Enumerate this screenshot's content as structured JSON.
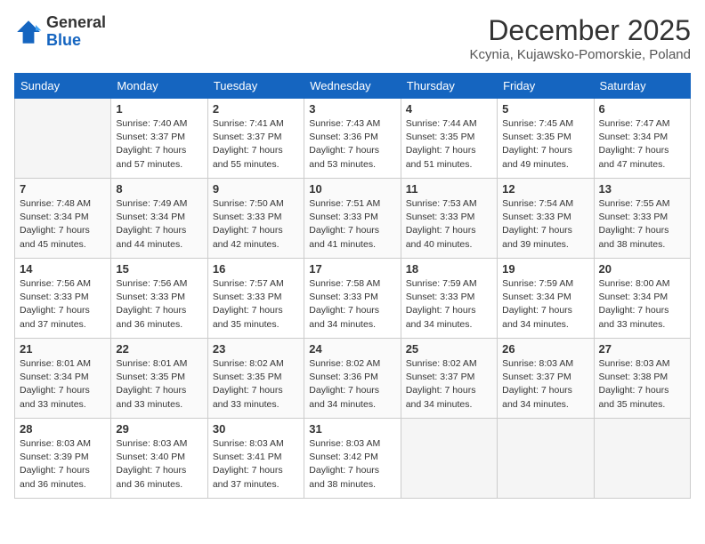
{
  "logo": {
    "general": "General",
    "blue": "Blue"
  },
  "title": "December 2025",
  "location": "Kcynia, Kujawsko-Pomorskie, Poland",
  "weekdays": [
    "Sunday",
    "Monday",
    "Tuesday",
    "Wednesday",
    "Thursday",
    "Friday",
    "Saturday"
  ],
  "weeks": [
    [
      {
        "day": "",
        "info": ""
      },
      {
        "day": "1",
        "info": "Sunrise: 7:40 AM\nSunset: 3:37 PM\nDaylight: 7 hours\nand 57 minutes."
      },
      {
        "day": "2",
        "info": "Sunrise: 7:41 AM\nSunset: 3:37 PM\nDaylight: 7 hours\nand 55 minutes."
      },
      {
        "day": "3",
        "info": "Sunrise: 7:43 AM\nSunset: 3:36 PM\nDaylight: 7 hours\nand 53 minutes."
      },
      {
        "day": "4",
        "info": "Sunrise: 7:44 AM\nSunset: 3:35 PM\nDaylight: 7 hours\nand 51 minutes."
      },
      {
        "day": "5",
        "info": "Sunrise: 7:45 AM\nSunset: 3:35 PM\nDaylight: 7 hours\nand 49 minutes."
      },
      {
        "day": "6",
        "info": "Sunrise: 7:47 AM\nSunset: 3:34 PM\nDaylight: 7 hours\nand 47 minutes."
      }
    ],
    [
      {
        "day": "7",
        "info": "Sunrise: 7:48 AM\nSunset: 3:34 PM\nDaylight: 7 hours\nand 45 minutes."
      },
      {
        "day": "8",
        "info": "Sunrise: 7:49 AM\nSunset: 3:34 PM\nDaylight: 7 hours\nand 44 minutes."
      },
      {
        "day": "9",
        "info": "Sunrise: 7:50 AM\nSunset: 3:33 PM\nDaylight: 7 hours\nand 42 minutes."
      },
      {
        "day": "10",
        "info": "Sunrise: 7:51 AM\nSunset: 3:33 PM\nDaylight: 7 hours\nand 41 minutes."
      },
      {
        "day": "11",
        "info": "Sunrise: 7:53 AM\nSunset: 3:33 PM\nDaylight: 7 hours\nand 40 minutes."
      },
      {
        "day": "12",
        "info": "Sunrise: 7:54 AM\nSunset: 3:33 PM\nDaylight: 7 hours\nand 39 minutes."
      },
      {
        "day": "13",
        "info": "Sunrise: 7:55 AM\nSunset: 3:33 PM\nDaylight: 7 hours\nand 38 minutes."
      }
    ],
    [
      {
        "day": "14",
        "info": "Sunrise: 7:56 AM\nSunset: 3:33 PM\nDaylight: 7 hours\nand 37 minutes."
      },
      {
        "day": "15",
        "info": "Sunrise: 7:56 AM\nSunset: 3:33 PM\nDaylight: 7 hours\nand 36 minutes."
      },
      {
        "day": "16",
        "info": "Sunrise: 7:57 AM\nSunset: 3:33 PM\nDaylight: 7 hours\nand 35 minutes."
      },
      {
        "day": "17",
        "info": "Sunrise: 7:58 AM\nSunset: 3:33 PM\nDaylight: 7 hours\nand 34 minutes."
      },
      {
        "day": "18",
        "info": "Sunrise: 7:59 AM\nSunset: 3:33 PM\nDaylight: 7 hours\nand 34 minutes."
      },
      {
        "day": "19",
        "info": "Sunrise: 7:59 AM\nSunset: 3:34 PM\nDaylight: 7 hours\nand 34 minutes."
      },
      {
        "day": "20",
        "info": "Sunrise: 8:00 AM\nSunset: 3:34 PM\nDaylight: 7 hours\nand 33 minutes."
      }
    ],
    [
      {
        "day": "21",
        "info": "Sunrise: 8:01 AM\nSunset: 3:34 PM\nDaylight: 7 hours\nand 33 minutes."
      },
      {
        "day": "22",
        "info": "Sunrise: 8:01 AM\nSunset: 3:35 PM\nDaylight: 7 hours\nand 33 minutes."
      },
      {
        "day": "23",
        "info": "Sunrise: 8:02 AM\nSunset: 3:35 PM\nDaylight: 7 hours\nand 33 minutes."
      },
      {
        "day": "24",
        "info": "Sunrise: 8:02 AM\nSunset: 3:36 PM\nDaylight: 7 hours\nand 34 minutes."
      },
      {
        "day": "25",
        "info": "Sunrise: 8:02 AM\nSunset: 3:37 PM\nDaylight: 7 hours\nand 34 minutes."
      },
      {
        "day": "26",
        "info": "Sunrise: 8:03 AM\nSunset: 3:37 PM\nDaylight: 7 hours\nand 34 minutes."
      },
      {
        "day": "27",
        "info": "Sunrise: 8:03 AM\nSunset: 3:38 PM\nDaylight: 7 hours\nand 35 minutes."
      }
    ],
    [
      {
        "day": "28",
        "info": "Sunrise: 8:03 AM\nSunset: 3:39 PM\nDaylight: 7 hours\nand 36 minutes."
      },
      {
        "day": "29",
        "info": "Sunrise: 8:03 AM\nSunset: 3:40 PM\nDaylight: 7 hours\nand 36 minutes."
      },
      {
        "day": "30",
        "info": "Sunrise: 8:03 AM\nSunset: 3:41 PM\nDaylight: 7 hours\nand 37 minutes."
      },
      {
        "day": "31",
        "info": "Sunrise: 8:03 AM\nSunset: 3:42 PM\nDaylight: 7 hours\nand 38 minutes."
      },
      {
        "day": "",
        "info": ""
      },
      {
        "day": "",
        "info": ""
      },
      {
        "day": "",
        "info": ""
      }
    ]
  ]
}
